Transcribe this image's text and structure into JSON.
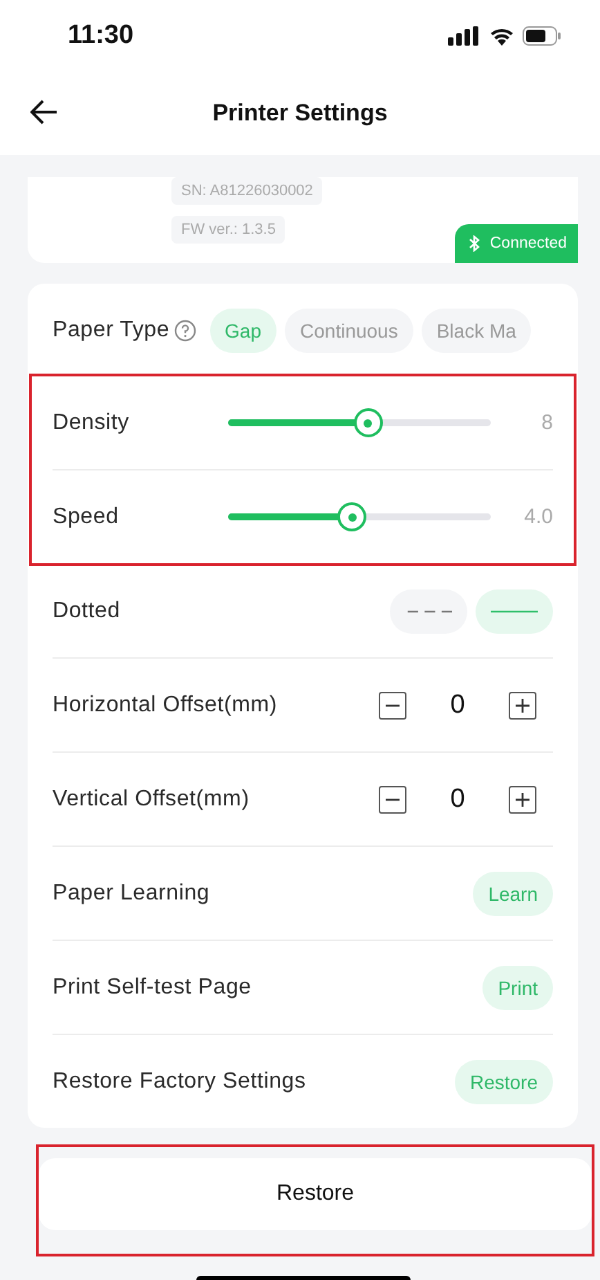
{
  "status_bar": {
    "time": "11:30"
  },
  "header": {
    "title": "Printer Settings"
  },
  "device": {
    "serial": "SN: A81226030002",
    "firmware": "FW ver.: 1.3.5",
    "status": "Connected"
  },
  "paper_type": {
    "label": "Paper Type",
    "options": [
      {
        "label": "Gap",
        "selected": true
      },
      {
        "label": "Continuous",
        "selected": false
      },
      {
        "label": "Black Ma",
        "selected": false
      }
    ]
  },
  "sliders_highlighted": true,
  "sliders": [
    {
      "label": "Density",
      "level": 0.53,
      "reading": "8"
    },
    {
      "label": "Speed",
      "level": 0.47,
      "reading": "4.0"
    }
  ],
  "dotted": {
    "label": "Dotted",
    "options": [
      {
        "kind": "dashed",
        "selected": false
      },
      {
        "kind": "solid",
        "selected": true
      }
    ]
  },
  "offsets": [
    {
      "label": "Horizontal Offset(mm)",
      "value": "0"
    },
    {
      "label": "Vertical Offset(mm)",
      "value": "0"
    }
  ],
  "actions": [
    {
      "label": "Paper Learning",
      "button": "Learn"
    },
    {
      "label": "Print Self-test Page",
      "button": "Print"
    },
    {
      "label": "Restore Factory Settings",
      "button": "Restore"
    }
  ],
  "restore_button": {
    "label": "Restore",
    "highlighted": true
  }
}
